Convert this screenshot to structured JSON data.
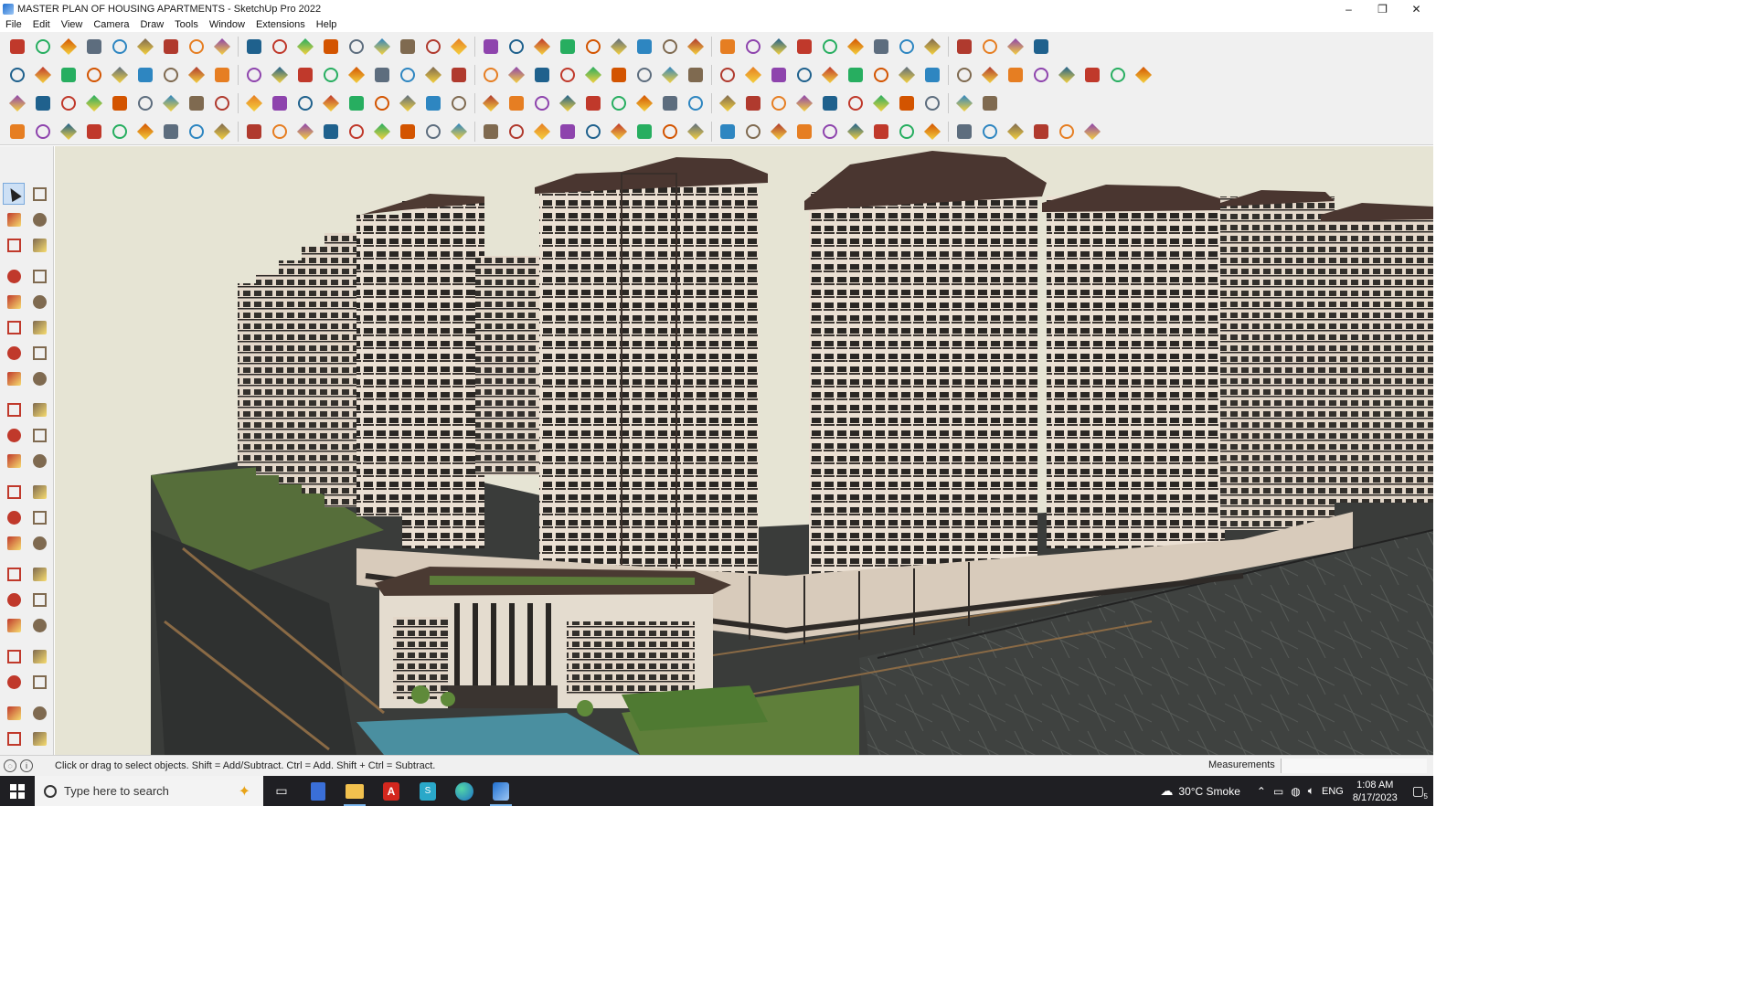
{
  "window": {
    "title": "MASTER PLAN OF HOUSING APARTMENTS - SketchUp Pro 2022",
    "controls": [
      "–",
      "❐",
      "✕"
    ]
  },
  "menu": [
    "File",
    "Edit",
    "View",
    "Camera",
    "Draw",
    "Tools",
    "Window",
    "Extensions",
    "Help"
  ],
  "toolbar_rows": [
    {
      "count": 40
    },
    {
      "count": 44
    },
    {
      "count": 38
    },
    {
      "count": 42
    }
  ],
  "left_tools": [
    "select-icon",
    "orbit-icon",
    "paint-bucket-icon",
    "eraser-icon",
    "components-icon",
    "tape-icon",
    "line-icon",
    "freehand-icon",
    "rectangle-icon",
    "rotated-rectangle-icon",
    "circle-icon",
    "polygon-icon",
    "arc-icon",
    "pie-icon",
    "two-point-arc-icon",
    "three-point-arc-icon",
    "move-icon",
    "push-pull-icon",
    "rotate-icon",
    "follow-me-icon",
    "scale-icon",
    "offset-icon",
    "tape-measure-icon",
    "dimension-icon",
    "protractor-icon",
    "text-icon",
    "axes-icon",
    "3d-text-icon",
    "orbit-tool-icon",
    "pan-icon",
    "zoom-icon",
    "zoom-window-icon",
    "zoom-extents-icon",
    "previous-view-icon",
    "position-camera-icon",
    "look-around-icon",
    "walk-icon",
    "section-plane-icon",
    "sandbox-icon",
    "smoove-icon",
    "stamp-icon",
    "drape-icon"
  ],
  "status": {
    "message": "Click or drag to select objects. Shift = Add/Subtract. Ctrl = Add. Shift + Ctrl = Subtract.",
    "measurements_label": "Measurements",
    "measurements_value": ""
  },
  "taskbar": {
    "search_placeholder": "Type here to search",
    "weather": "30°C  Smoke",
    "language": "ENG",
    "time": "1:08 AM",
    "date": "8/17/2023",
    "notification_count": "5"
  },
  "colors": {
    "viewport_sky": "#e6e4d4",
    "tower_facade": "#e9ddd0",
    "roof": "#5a3e34",
    "ground": "#3b3d3b",
    "grass": "#5c7d3a",
    "taskbar": "#1f1f23"
  }
}
